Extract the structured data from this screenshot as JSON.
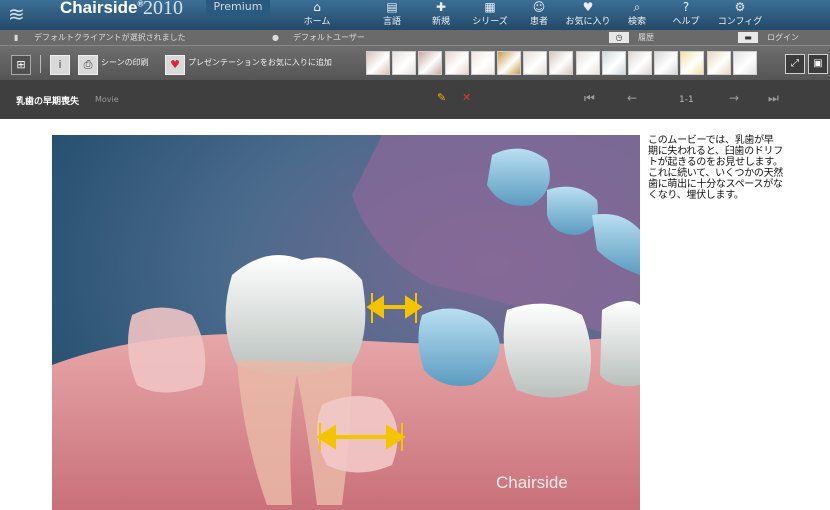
{
  "app": {
    "brand": "Chairside",
    "brand_mark": "®",
    "year": "2010",
    "edition": "Premium"
  },
  "nav": [
    {
      "label": "ホーム",
      "icon": "home-icon"
    },
    {
      "label": "言語",
      "icon": "language-icon"
    },
    {
      "label": "新規",
      "icon": "new-icon"
    },
    {
      "label": "シリーズ",
      "icon": "series-icon"
    },
    {
      "label": "患者",
      "icon": "patient-icon"
    },
    {
      "label": "お気に入り",
      "icon": "favorites-icon"
    },
    {
      "label": "検索",
      "icon": "search-icon"
    },
    {
      "label": "ヘルプ",
      "icon": "help-icon"
    },
    {
      "label": "コンフィグ",
      "icon": "config-icon"
    }
  ],
  "status": {
    "client": "デフォルトクライアントが選択されました",
    "user": "デフォルトユーザー",
    "history": "履歴",
    "login": "ログイン"
  },
  "toolbar": {
    "print_scene": "シーンの印刷",
    "add_favorite": "プレゼンテーションをお気に入りに追加",
    "thumb_colors": [
      "#d8c2b8",
      "#e6e0dc",
      "#c9a7a0",
      "#e7d4ce",
      "#f0e6e2",
      "#c89a4a",
      "#e4ded9",
      "#d4c7bf",
      "#e8e2de",
      "#cfd8de",
      "#ddd7d2",
      "#d8d8d8",
      "#f2e1a6",
      "#e6d9bf",
      "#e3e3e3"
    ]
  },
  "content": {
    "title": "乳歯の早期喪失",
    "type": "Movie",
    "page": "1-1",
    "caption": "このムービーでは、乳歯が早期に失われると、臼歯のドリフトが起きるのをお見せします。これに続いて、いくつかの天然歯に萌出に十分なスペースがなくなり、埋伏します。",
    "watermark": "Chairside"
  }
}
